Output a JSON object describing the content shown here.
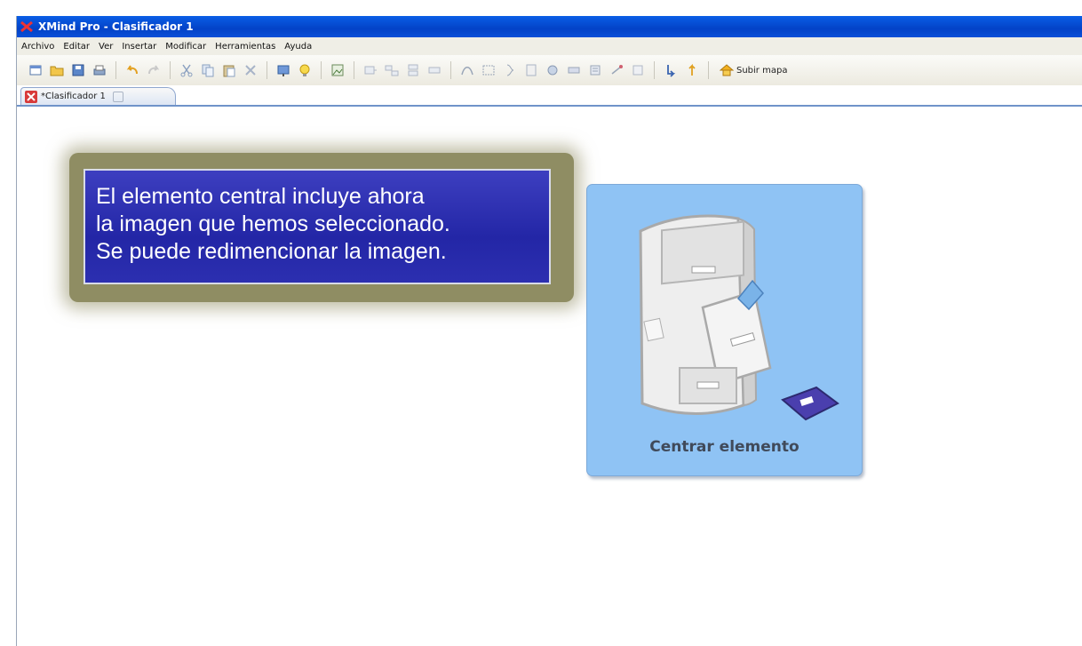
{
  "window": {
    "title": "XMind Pro - Clasificador 1"
  },
  "menu": [
    "Archivo",
    "Editar",
    "Ver",
    "Insertar",
    "Modificar",
    "Herramientas",
    "Ayuda"
  ],
  "toolbar": {
    "subir_mapa_label": "Subir mapa"
  },
  "tab": {
    "label": "*Clasificador 1"
  },
  "note": {
    "lines": [
      "El elemento central incluye ahora",
      "la imagen que hemos seleccionado.",
      "Se puede redimencionar la imagen."
    ]
  },
  "central_topic": {
    "label": "Centrar elemento"
  },
  "colors": {
    "titlebar": "#0342c7",
    "note_bg": "#2326a6",
    "note_glow": "#8f8d63",
    "topic_bg": "#8fc3f4"
  }
}
